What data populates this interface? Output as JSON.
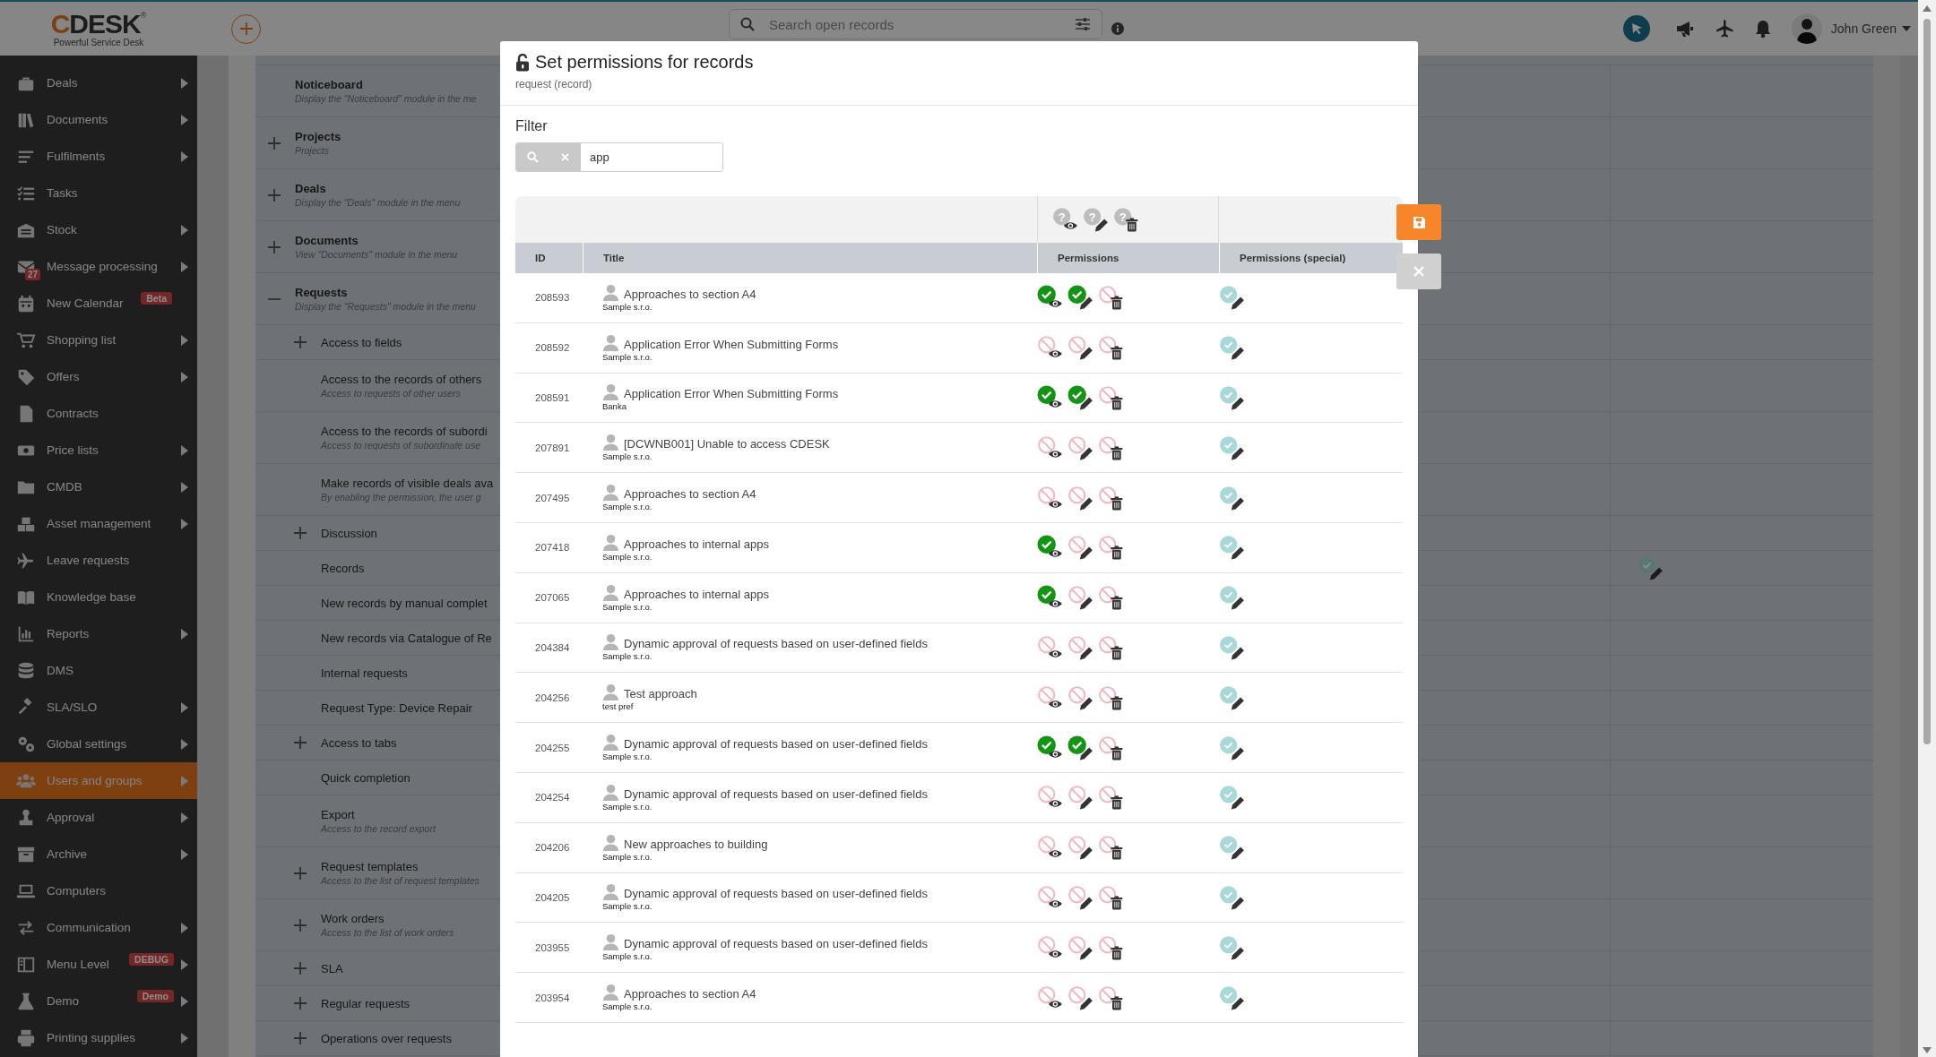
{
  "topbar": {
    "logo": "CDESK",
    "logo_mark": "®",
    "tagline": "Powerful Service Desk",
    "search": {
      "placeholder": "Search open records"
    },
    "user": {
      "name": "John Green"
    }
  },
  "sidebar": {
    "items": [
      {
        "label": "Deals",
        "selected": false,
        "submenu": true
      },
      {
        "label": "Documents",
        "selected": false,
        "submenu": true
      },
      {
        "label": "Fulfilments",
        "selected": false,
        "submenu": true
      },
      {
        "label": "Tasks",
        "selected": false,
        "submenu": false
      },
      {
        "label": "Stock",
        "selected": false,
        "submenu": true
      },
      {
        "label": "Message processing",
        "selected": false,
        "submenu": true,
        "badge": {
          "text": "27",
          "kind": "count"
        }
      },
      {
        "label": "New Calendar",
        "selected": false,
        "submenu": false,
        "badge": {
          "text": "Beta",
          "kind": "tag"
        }
      },
      {
        "label": "Shopping list",
        "selected": false,
        "submenu": true
      },
      {
        "label": "Offers",
        "selected": false,
        "submenu": true
      },
      {
        "label": "Contracts",
        "selected": false,
        "submenu": false
      },
      {
        "label": "Price lists",
        "selected": false,
        "submenu": true
      },
      {
        "label": "CMDB",
        "selected": false,
        "submenu": true
      },
      {
        "label": "Asset management",
        "selected": false,
        "submenu": true
      },
      {
        "label": "Leave requests",
        "selected": false,
        "submenu": false
      },
      {
        "label": "Knowledge base",
        "selected": false,
        "submenu": false
      },
      {
        "label": "Reports",
        "selected": false,
        "submenu": true
      },
      {
        "label": "DMS",
        "selected": false,
        "submenu": false
      },
      {
        "label": "SLA/SLO",
        "selected": false,
        "submenu": true
      },
      {
        "label": "Global settings",
        "selected": false,
        "submenu": true
      },
      {
        "label": "Users and groups",
        "selected": true,
        "submenu": true
      },
      {
        "label": "Approval",
        "selected": false,
        "submenu": true
      },
      {
        "label": "Archive",
        "selected": false,
        "submenu": true
      },
      {
        "label": "Computers",
        "selected": false,
        "submenu": false
      },
      {
        "label": "Communication",
        "selected": false,
        "submenu": true
      },
      {
        "label": "Menu Level",
        "selected": false,
        "submenu": true,
        "badge": {
          "text": "DEBUG",
          "kind": "tag"
        }
      },
      {
        "label": "Demo",
        "selected": false,
        "submenu": true,
        "badge": {
          "text": "Demo",
          "kind": "tag"
        }
      },
      {
        "label": "Printing supplies",
        "selected": false,
        "submenu": true
      }
    ]
  },
  "permission_tree": [
    {
      "title": "Noticeboard",
      "description": "Display the \"Noticeboard\" module in the me",
      "expandable": false,
      "special": false
    },
    {
      "title": "Projects",
      "description": "Projects",
      "expandable": true,
      "expanded": false,
      "special": false
    },
    {
      "title": "Deals",
      "description": "Display the \"Deals\" module in the menu",
      "expandable": true,
      "expanded": false,
      "special": false
    },
    {
      "title": "Documents",
      "description": "View \"Documents\" module in the menu",
      "expandable": true,
      "expanded": false,
      "special": false
    },
    {
      "title": "Requests",
      "description": "Display the \"Requests\" module in the menu",
      "expandable": true,
      "expanded": true,
      "special": false,
      "children": [
        {
          "title": "Access to fields",
          "expandable": true,
          "expanded": false,
          "special": false
        },
        {
          "title": "Access to the records of others",
          "description": "Access to requests of other users",
          "expandable": false,
          "special": false
        },
        {
          "title": "Access to the records of subordi",
          "description": "Access to requests of subordinate use",
          "expandable": false,
          "special": false
        },
        {
          "title": "Make records of visible deals ava",
          "description": "By enabling the permission, the user g",
          "expandable": false,
          "special": false
        },
        {
          "title": "Discussion",
          "expandable": true,
          "expanded": false,
          "special": false
        },
        {
          "title": "Records",
          "expandable": false,
          "special": true
        },
        {
          "title": "New records by manual complet",
          "expandable": false,
          "special": false
        },
        {
          "title": "New records via Catalogue of Re",
          "expandable": false,
          "special": false
        },
        {
          "title": "Internal requests",
          "expandable": false,
          "special": false
        },
        {
          "title": "Request Type: Device Repair",
          "expandable": false,
          "special": false
        },
        {
          "title": "Access to tabs",
          "expandable": true,
          "expanded": false,
          "special": false
        },
        {
          "title": "Quick completion",
          "expandable": false,
          "special": false
        },
        {
          "title": "Export",
          "description": "Access to the record export",
          "expandable": false,
          "special": false
        },
        {
          "title": "Request templates",
          "description": "Access to the list of request templates",
          "expandable": true,
          "expanded": false,
          "special": false
        },
        {
          "title": "Work orders",
          "description": "Access to the list of work orders",
          "expandable": true,
          "expanded": false,
          "special": false
        },
        {
          "title": "SLA",
          "expandable": true,
          "expanded": false,
          "special": false
        },
        {
          "title": "Regular requests",
          "expandable": true,
          "expanded": false,
          "special": false
        },
        {
          "title": "Operations over requests",
          "expandable": true,
          "expanded": false,
          "special": false
        }
      ]
    }
  ],
  "dialog": {
    "title": "Set permissions for records",
    "subtitle": "request (record)",
    "filter": {
      "label": "Filter",
      "value": "app"
    },
    "header_icons": [
      {
        "kind": "view",
        "glyph": "?"
      },
      {
        "kind": "edit",
        "glyph": "?"
      },
      {
        "kind": "delete",
        "glyph": "?"
      }
    ],
    "columns": [
      "ID",
      "Title",
      "Permissions",
      "Permissions (special)"
    ],
    "rows": [
      {
        "id": "208593",
        "title": "Approaches to section A4",
        "company": "Sample s.r.o.",
        "view": true,
        "edit": true,
        "delete": false,
        "special": true
      },
      {
        "id": "208592",
        "title": "Application Error When Submitting Forms",
        "company": "Sample s.r.o.",
        "view": false,
        "edit": false,
        "delete": false,
        "special": true
      },
      {
        "id": "208591",
        "title": "Application Error When Submitting Forms",
        "company": "Banka",
        "view": true,
        "edit": true,
        "delete": false,
        "special": true
      },
      {
        "id": "207891",
        "title": "[DCWNB001] Unable to access CDESK",
        "company": "Sample s.r.o.",
        "view": false,
        "edit": false,
        "delete": false,
        "special": true
      },
      {
        "id": "207495",
        "title": "Approaches to section A4",
        "company": "Sample s.r.o.",
        "view": false,
        "edit": false,
        "delete": false,
        "special": true
      },
      {
        "id": "207418",
        "title": "Approaches to internal apps",
        "company": "Sample s.r.o.",
        "view": true,
        "edit": false,
        "delete": false,
        "special": true
      },
      {
        "id": "207065",
        "title": "Approaches to internal apps",
        "company": "Sample s.r.o.",
        "view": true,
        "edit": false,
        "delete": false,
        "special": true
      },
      {
        "id": "204384",
        "title": "Dynamic approval of requests based on user-defined fields",
        "company": "Sample s.r.o.",
        "view": false,
        "edit": false,
        "delete": false,
        "special": true
      },
      {
        "id": "204256",
        "title": "Test approach",
        "company": "test pref",
        "view": false,
        "edit": false,
        "delete": false,
        "special": true
      },
      {
        "id": "204255",
        "title": "Dynamic approval of requests based on user-defined fields",
        "company": "Sample s.r.o.",
        "view": true,
        "edit": true,
        "delete": false,
        "special": true
      },
      {
        "id": "204254",
        "title": "Dynamic approval of requests based on user-defined fields",
        "company": "Sample s.r.o.",
        "view": false,
        "edit": false,
        "delete": false,
        "special": true
      },
      {
        "id": "204206",
        "title": "New approaches to building",
        "company": "Sample s.r.o.",
        "view": false,
        "edit": false,
        "delete": false,
        "special": true
      },
      {
        "id": "204205",
        "title": "Dynamic approval of requests based on user-defined fields",
        "company": "Sample s.r.o.",
        "view": false,
        "edit": false,
        "delete": false,
        "special": true
      },
      {
        "id": "203955",
        "title": "Dynamic approval of requests based on user-defined fields",
        "company": "Sample s.r.o.",
        "view": false,
        "edit": false,
        "delete": false,
        "special": true
      },
      {
        "id": "203954",
        "title": "Approaches to section A4",
        "company": "Sample s.r.o.",
        "view": false,
        "edit": false,
        "delete": false,
        "special": true
      }
    ]
  }
}
